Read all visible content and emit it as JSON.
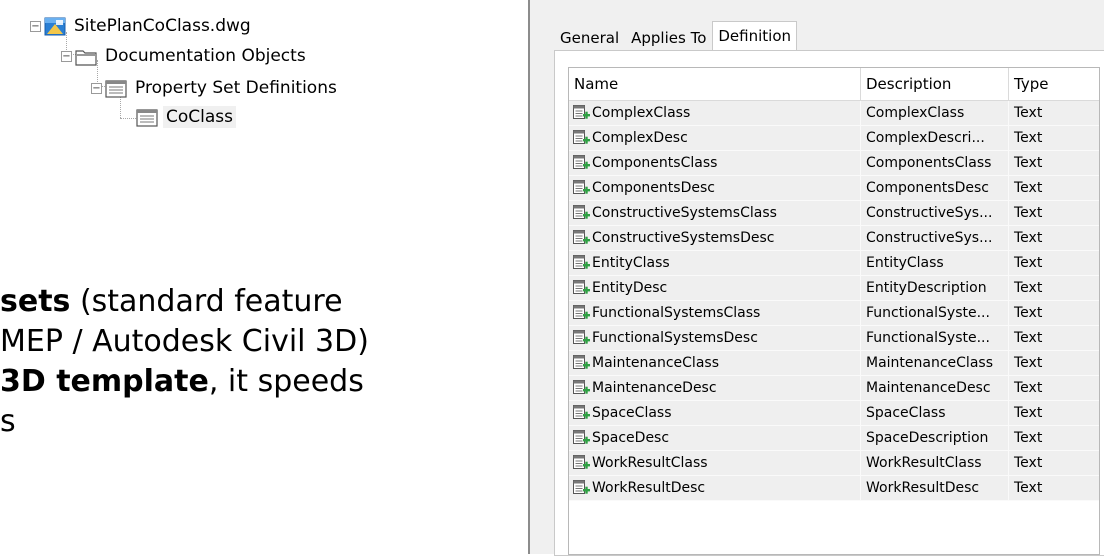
{
  "tree": {
    "root": "SitePlanCoClass.dwg",
    "level1": "Documentation Objects",
    "level2": "Property Set Definitions",
    "level3": "CoClass"
  },
  "slide_text": {
    "line1_bold": "sets",
    "line1_rest": " (standard feature",
    "line2": "MEP / Autodesk Civil 3D)",
    "line3_bold": "3D template",
    "line3_rest": ", it speeds",
    "line4": "s"
  },
  "dialog": {
    "tabs": [
      "General",
      "Applies To",
      "Definition"
    ],
    "active_tab": "Definition",
    "columns": [
      "Name",
      "Description",
      "Type"
    ],
    "rows": [
      {
        "name": "ComplexClass",
        "description": "ComplexClass",
        "type": "Text"
      },
      {
        "name": "ComplexDesc",
        "description": "ComplexDescri...",
        "type": "Text"
      },
      {
        "name": "ComponentsClass",
        "description": "ComponentsClass",
        "type": "Text"
      },
      {
        "name": "ComponentsDesc",
        "description": "ComponentsDesc",
        "type": "Text"
      },
      {
        "name": "ConstructiveSystemsClass",
        "description": "ConstructiveSys...",
        "type": "Text"
      },
      {
        "name": "ConstructiveSystemsDesc",
        "description": "ConstructiveSys...",
        "type": "Text"
      },
      {
        "name": "EntityClass",
        "description": "EntityClass",
        "type": "Text"
      },
      {
        "name": "EntityDesc",
        "description": "EntityDescription",
        "type": "Text"
      },
      {
        "name": "FunctionalSystemsClass",
        "description": "FunctionalSyste...",
        "type": "Text"
      },
      {
        "name": "FunctionalSystemsDesc",
        "description": "FunctionalSyste...",
        "type": "Text"
      },
      {
        "name": "MaintenanceClass",
        "description": "MaintenanceClass",
        "type": "Text"
      },
      {
        "name": "MaintenanceDesc",
        "description": "MaintenanceDesc",
        "type": "Text"
      },
      {
        "name": "SpaceClass",
        "description": "SpaceClass",
        "type": "Text"
      },
      {
        "name": "SpaceDesc",
        "description": "SpaceDescription",
        "type": "Text"
      },
      {
        "name": "WorkResultClass",
        "description": "WorkResultClass",
        "type": "Text"
      },
      {
        "name": "WorkResultDesc",
        "description": "WorkResultDesc",
        "type": "Text"
      }
    ]
  },
  "icons": {
    "drawing": "dwg-file-icon",
    "folder": "folder-icon",
    "property-set": "property-set-icon",
    "property": "property-add-icon"
  },
  "colors": {
    "row_bg": "#efefef",
    "icon_green": "#2ea043",
    "dwg_blue": "#2a7fd4",
    "dwg_yellow": "#f3c74a"
  }
}
